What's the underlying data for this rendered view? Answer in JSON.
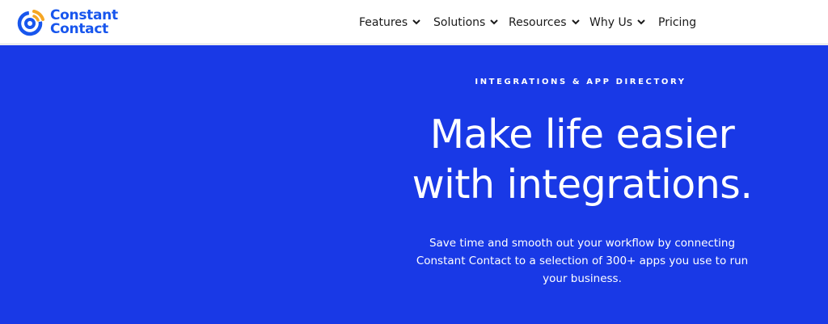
{
  "brand": {
    "name_line1": "Constant",
    "name_line2": "Contact",
    "logo_icon": "constant-contact-logo-icon",
    "color_blue": "#1856ed",
    "color_orange": "#f5a623"
  },
  "nav": {
    "items": [
      {
        "label": "Features",
        "has_dropdown": true
      },
      {
        "label": "Solutions",
        "has_dropdown": true
      },
      {
        "label": "Resources",
        "has_dropdown": true
      },
      {
        "label": "Why Us",
        "has_dropdown": true
      },
      {
        "label": "Pricing",
        "has_dropdown": false
      }
    ],
    "dropdown_icon": "chevron-down-icon"
  },
  "hero": {
    "background_color": "#1939e6",
    "eyebrow": "INTEGRATIONS & APP DIRECTORY",
    "headline_line1": "Make life easier",
    "headline_line2": "with integrations.",
    "subtext": "Save time and smooth out your workflow by connecting Constant Contact to a selection of 300+ apps you use to run your business."
  }
}
